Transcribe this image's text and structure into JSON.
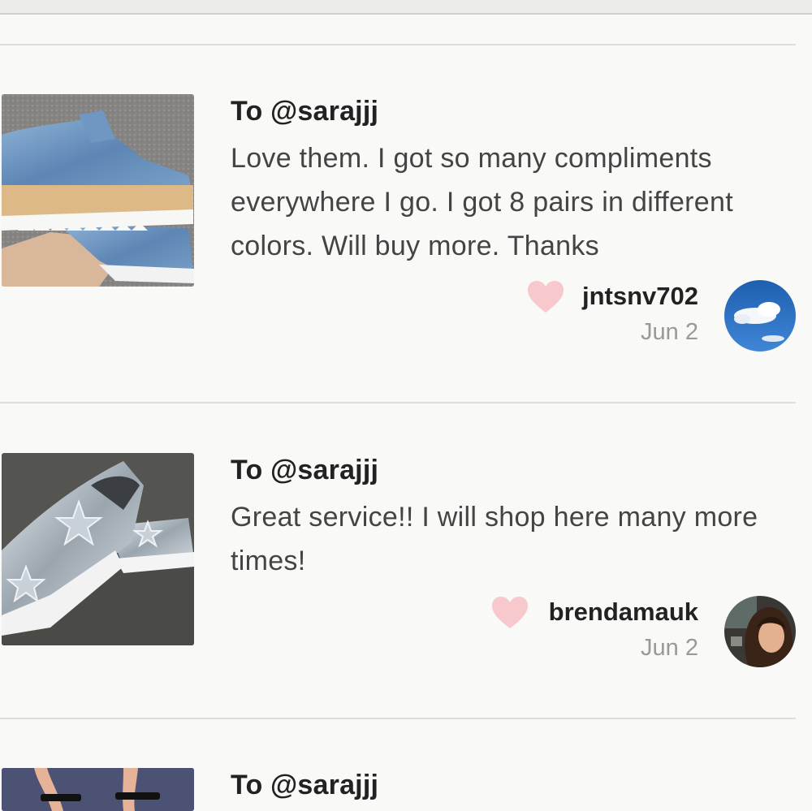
{
  "reviews": [
    {
      "to": "To @sarajjj",
      "text": "Love them. I got so many compliments everywhere I go. I got 8 pairs in different colors. Will buy more. Thanks",
      "username": "jntsnv702",
      "date": "Jun 2",
      "thumbnail": "denim-platform-shoe-photo",
      "avatar": "sky-clouds-avatar"
    },
    {
      "to": "To @sarajjj",
      "text": "Great service!! I will shop here many more times!",
      "username": "brendamauk",
      "date": "Jun 2",
      "thumbnail": "silver-star-slip-on-photo",
      "avatar": "woman-portrait-avatar"
    },
    {
      "to": "To @sarajjj",
      "thumbnail": "black-strap-heels-photo"
    }
  ],
  "colors": {
    "background": "#f9f9f7",
    "heart": "#f7c9cc",
    "date": "#999999",
    "divider": "#dedede"
  }
}
